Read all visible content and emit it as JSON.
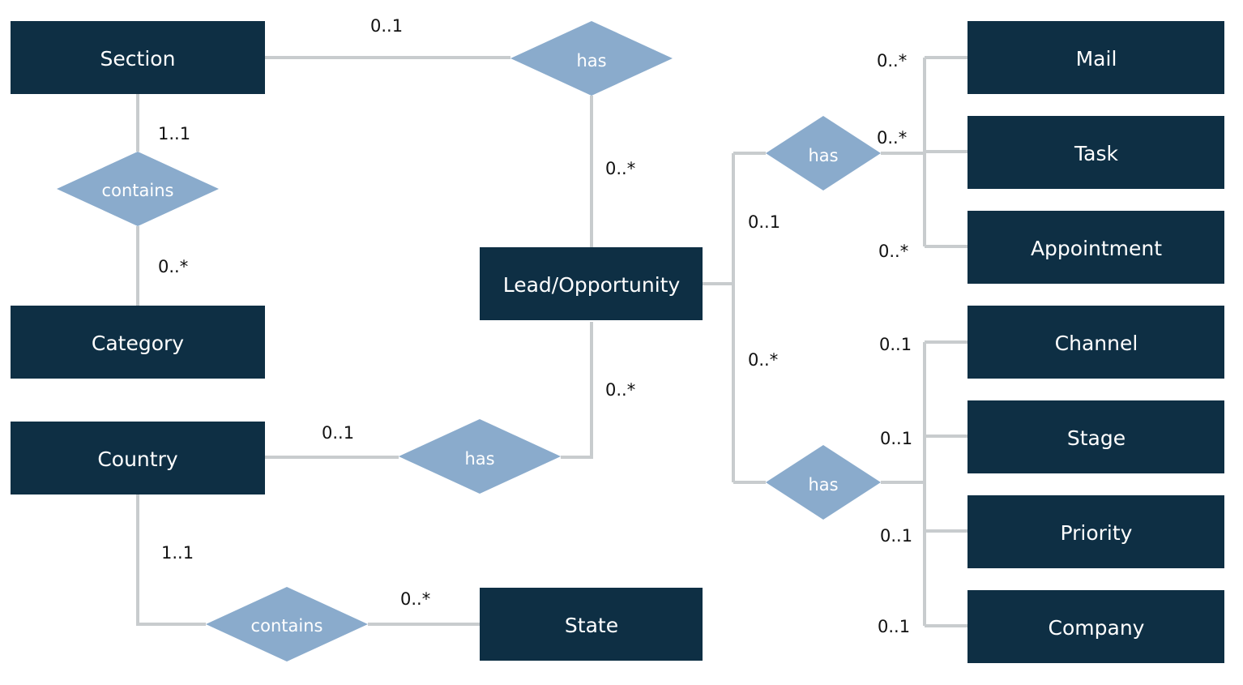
{
  "entities": {
    "section": "Section",
    "category": "Category",
    "country": "Country",
    "lead": "Lead/Opportunity",
    "state": "State",
    "mail": "Mail",
    "task": "Task",
    "appointment": "Appointment",
    "channel": "Channel",
    "stage": "Stage",
    "priority": "Priority",
    "company": "Company"
  },
  "relationships": {
    "section_lead": "has",
    "section_category": "contains",
    "country_lead": "has",
    "country_state": "contains",
    "lead_activities": "has",
    "lead_attributes": "has"
  },
  "cardinalities": {
    "section_has": "0..1",
    "lead_has_section": "0..*",
    "section_contains": "1..1",
    "category_contains": "0..*",
    "country_has": "0..1",
    "lead_has_country": "0..*",
    "country_contains": "1..1",
    "state_contains": "0..*",
    "lead_activities": "0..1",
    "lead_attributes": "0..*",
    "mail": "0..*",
    "task": "0..*",
    "appointment": "0..*",
    "channel": "0..1",
    "stage": "0..1",
    "priority": "0..1",
    "company": "0..1"
  },
  "colors": {
    "entity": "#0e2f44",
    "relationship": "#8aabcc",
    "connector": "#c8ccce"
  }
}
